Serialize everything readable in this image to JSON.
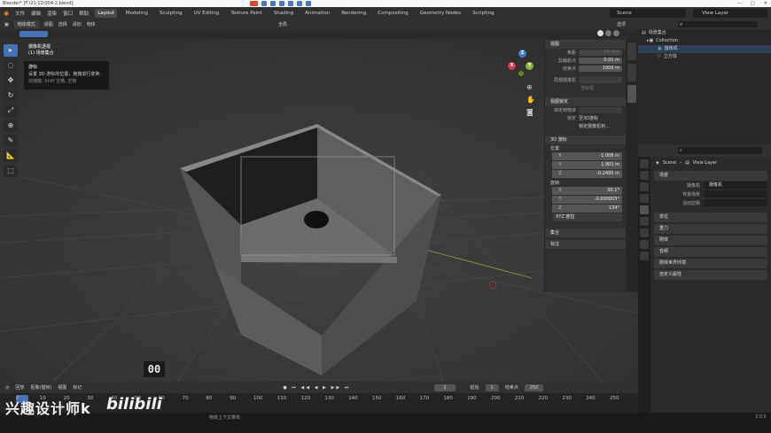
{
  "window": {
    "title": "Blender* [F:\\21-12\\004-2.blend]",
    "min": "—",
    "max": "□",
    "close": "✕"
  },
  "menu": {
    "items": [
      "文件",
      "编辑",
      "渲染",
      "窗口",
      "帮助"
    ]
  },
  "workspaces": [
    "Layout",
    "Modeling",
    "Sculpting",
    "UV Editing",
    "Texture Paint",
    "Shading",
    "Animation",
    "Rendering",
    "Compositing",
    "Geometry Nodes",
    "Scripting"
  ],
  "scene_name": "Scene",
  "view_layer_name": "View Layer",
  "viewport_header": {
    "mode": "物体模式",
    "items": [
      "视图",
      "选择",
      "添加",
      "物体"
    ],
    "orientation": "全局",
    "options": "选项"
  },
  "camera_label": {
    "line1": "摄像机透视",
    "line2": "(1) 场景集合"
  },
  "tooltip": {
    "title": "游标",
    "desc": "设置 3D 游标的位置，拖拽进行变换.",
    "shortcut": "快捷键: Shift 空格, 空格"
  },
  "tools": [
    "▸",
    "◌",
    "✥",
    "↻",
    "⤢",
    "⊕",
    "✎",
    "📐",
    "⬚"
  ],
  "counter": "00",
  "npanel": {
    "view_section": "视图",
    "focal_label": "焦距",
    "focal_value": "50 mm",
    "clip_start_label": "剪裁起点",
    "clip_start_value": "0.01 m",
    "clip_end_label": "结束点",
    "clip_end_value": "1000 m",
    "local_cam_label": "局部摄像机",
    "render_region": "渲染框",
    "view_lock_section": "视图锁定",
    "lock_to_obj_label": "锁定到物体",
    "lock_label": "锁定",
    "lock_3d_cursor": "至3D游标",
    "lock_cam_view": "锁定摄像机到...",
    "cursor_section": "3D 游标",
    "location_label": "位置:",
    "loc": [
      {
        "a": "X",
        "v": "-1.006 m"
      },
      {
        "a": "Y",
        "v": "1.901 m"
      },
      {
        "a": "Z",
        "v": "-0.2495 m"
      }
    ],
    "rotation_label": "旋转:",
    "rot": [
      {
        "a": "X",
        "v": "50.1°"
      },
      {
        "a": "Y",
        "v": "-0.000003°"
      },
      {
        "a": "Z",
        "v": "134°"
      }
    ],
    "rot_mode": "XYZ 欧拉",
    "collection_section": "集合",
    "annotation_section": "标注"
  },
  "outliner": {
    "root": "场景集合",
    "collection": "Collection",
    "items": [
      "摄像机",
      "立方体"
    ]
  },
  "properties": {
    "breadcrumb_scene": "Scene",
    "breadcrumb_layer": "View Layer",
    "scene_section": "场景",
    "camera_label": "摄像机",
    "camera_value": "摄像机",
    "bg_scene_label": "背景场景",
    "active_clip_label": "活动剪辑",
    "sections": [
      "单位",
      "重力",
      "刚体",
      "音频",
      "刚体世界环境",
      "自定义属性"
    ]
  },
  "timeline": {
    "items": [
      "回放",
      "抠像(插帧)",
      "视图",
      "标记"
    ],
    "current_frame": "1",
    "start_label": "起始",
    "start_value": "1",
    "end_label": "结束点",
    "end_value": "250",
    "frames": [
      "0",
      "10",
      "20",
      "30",
      "40",
      "50",
      "60",
      "70",
      "80",
      "90",
      "100",
      "110",
      "120",
      "130",
      "140",
      "150",
      "160",
      "170",
      "180",
      "190",
      "200",
      "210",
      "220",
      "230",
      "240",
      "250"
    ]
  },
  "status": {
    "hint": "物体上下文菜单",
    "version": "3.0.0"
  },
  "watermark": {
    "text": "兴趣设计师k",
    "logo": "bilibili"
  },
  "gizmo": {
    "x": "X",
    "y": "Y",
    "z": "Z"
  }
}
